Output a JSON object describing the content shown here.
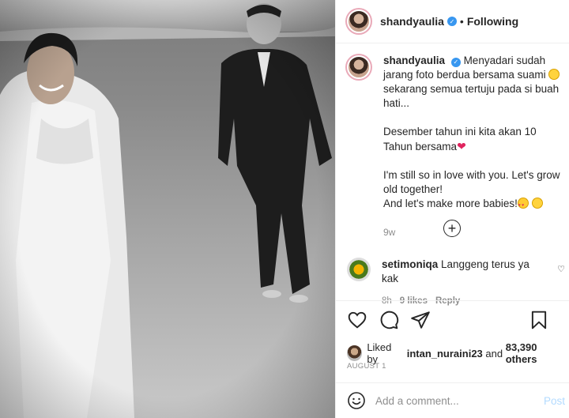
{
  "post": {
    "username": "shandyaulia",
    "verified": true,
    "follow_status": "Following",
    "separator": "•"
  },
  "caption": {
    "username": "shandyaulia",
    "para1_a": "Menyadari sudah jarang foto berdua bersama suami",
    "para1_b": "sekarang semua tertuju pada si buah hati...",
    "para2": "Desember tahun ini kita akan 10 Tahun bersama",
    "para3": "I'm still so in love with you. Let's grow old together!",
    "para4": "And let's make more babies!",
    "time": "9w"
  },
  "load_more_symbol": "+",
  "comments": [
    {
      "username": "setimoniqa",
      "text": "Langgeng terus ya kak",
      "time": "8h",
      "likes": "9 likes",
      "reply": "Reply"
    }
  ],
  "likes": {
    "prefix": "Liked by",
    "user": "intan_nuraini23",
    "middle": "and",
    "others": "83,390 others"
  },
  "date": "AUGUST 1",
  "add_comment": {
    "placeholder": "Add a comment...",
    "post_label": "Post"
  },
  "icons": {
    "verified": "verified-badge-icon",
    "like": "heart-icon",
    "comment": "comment-bubble-icon",
    "share": "paper-plane-icon",
    "save": "bookmark-icon",
    "emoji": "smile-icon",
    "load_more": "plus-circle-icon"
  },
  "colors": {
    "verified": "#3897f0",
    "post_disabled": "#b3dbff",
    "meta_gray": "#8e8e8e"
  }
}
